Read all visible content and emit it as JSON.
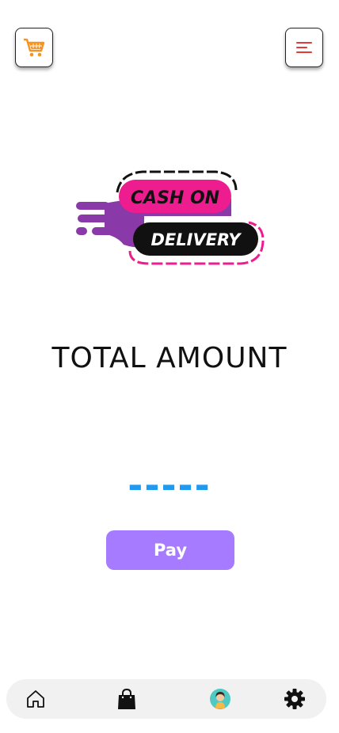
{
  "header": {
    "cart_icon": "shopping-cart-icon",
    "menu_icon": "hamburger-menu-icon"
  },
  "logo": {
    "line1": "CASH ON",
    "line2": "DELIVERY"
  },
  "main": {
    "total_label": "TOTAL AMOUNT",
    "amount_value": "-----",
    "pay_label": "Pay"
  },
  "bottom_nav": {
    "items": [
      {
        "icon": "home-icon"
      },
      {
        "icon": "shopping-bag-icon"
      },
      {
        "icon": "profile-avatar-icon"
      },
      {
        "icon": "settings-gear-icon"
      }
    ]
  },
  "colors": {
    "accent_pay": "#a77bff",
    "amount_blue": "#1e9af0",
    "menu_red": "#e53935",
    "cart_orange": "#f7931e",
    "logo_pink": "#ee1d8f",
    "logo_purple": "#8a3aa8"
  }
}
